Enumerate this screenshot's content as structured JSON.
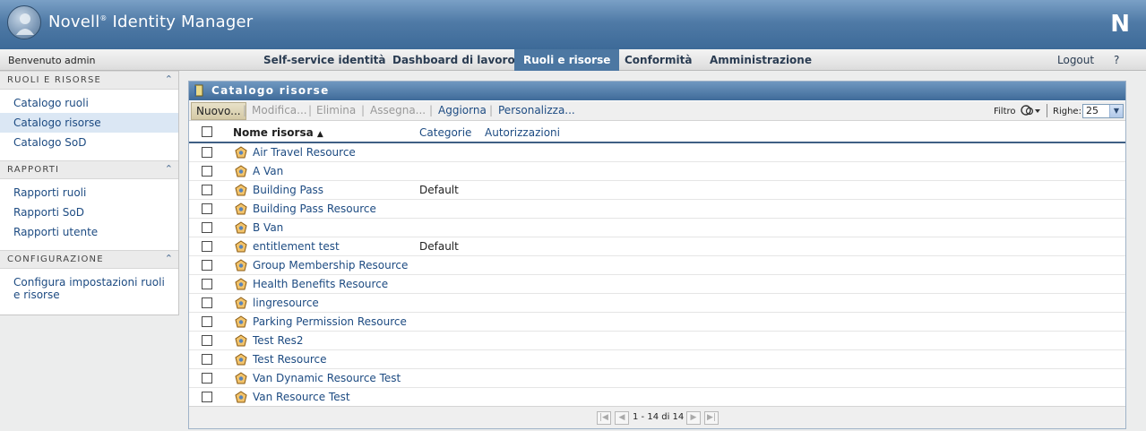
{
  "app": {
    "title": "Novell",
    "title_mark": "®",
    "title_rest": " Identity Manager",
    "brand": "N"
  },
  "nav": {
    "welcome": "Benvenuto admin",
    "tabs": [
      {
        "label": "Self-service identità",
        "active": false
      },
      {
        "label": "Dashboard di lavoro",
        "active": false
      },
      {
        "label": "Ruoli e risorse",
        "active": true
      },
      {
        "label": "Conformità",
        "active": false
      },
      {
        "label": "Amministrazione",
        "active": false
      }
    ],
    "logout": "Logout",
    "help": "?"
  },
  "sidebar": {
    "sections": [
      {
        "title": "RUOLI E RISORSE",
        "items": [
          {
            "label": "Catalogo ruoli",
            "active": false
          },
          {
            "label": "Catalogo risorse",
            "active": true
          },
          {
            "label": "Catalogo SoD",
            "active": false
          }
        ]
      },
      {
        "title": "RAPPORTI",
        "items": [
          {
            "label": "Rapporti ruoli",
            "active": false
          },
          {
            "label": "Rapporti SoD",
            "active": false
          },
          {
            "label": "Rapporti utente",
            "active": false
          }
        ]
      },
      {
        "title": "CONFIGURAZIONE",
        "items": [
          {
            "label": "Configura impostazioni ruoli e risorse",
            "active": false
          }
        ]
      }
    ]
  },
  "panel": {
    "title": "Catalogo risorse",
    "toolbar": {
      "new": "Nuovo...",
      "edit": "Modifica...",
      "delete": "Elimina",
      "assign": "Assegna...",
      "refresh": "Aggiorna",
      "customize": "Personalizza...",
      "filter": "Filtro",
      "rows_label": "Righe:",
      "rows_value": "25"
    },
    "columns": {
      "name": "Nome risorsa",
      "categories": "Categorie",
      "authorizations": "Autorizzazioni"
    },
    "rows": [
      {
        "name": "Air Travel Resource",
        "category": ""
      },
      {
        "name": "A Van",
        "category": ""
      },
      {
        "name": "Building Pass",
        "category": "Default"
      },
      {
        "name": "Building Pass Resource",
        "category": ""
      },
      {
        "name": "B Van",
        "category": ""
      },
      {
        "name": "entitlement test",
        "category": "Default"
      },
      {
        "name": "Group Membership Resource",
        "category": ""
      },
      {
        "name": "Health Benefits Resource",
        "category": ""
      },
      {
        "name": "lingresource",
        "category": ""
      },
      {
        "name": "Parking Permission Resource",
        "category": ""
      },
      {
        "name": "Test Res2",
        "category": ""
      },
      {
        "name": "Test Resource",
        "category": ""
      },
      {
        "name": "Van Dynamic Resource Test",
        "category": ""
      },
      {
        "name": "Van Resource Test",
        "category": ""
      }
    ],
    "pager": {
      "text": "1 - 14 di 14"
    }
  },
  "colors": {
    "header": "#3d6a98",
    "active_tab": "#4c77a2",
    "link": "#1d4b82"
  }
}
